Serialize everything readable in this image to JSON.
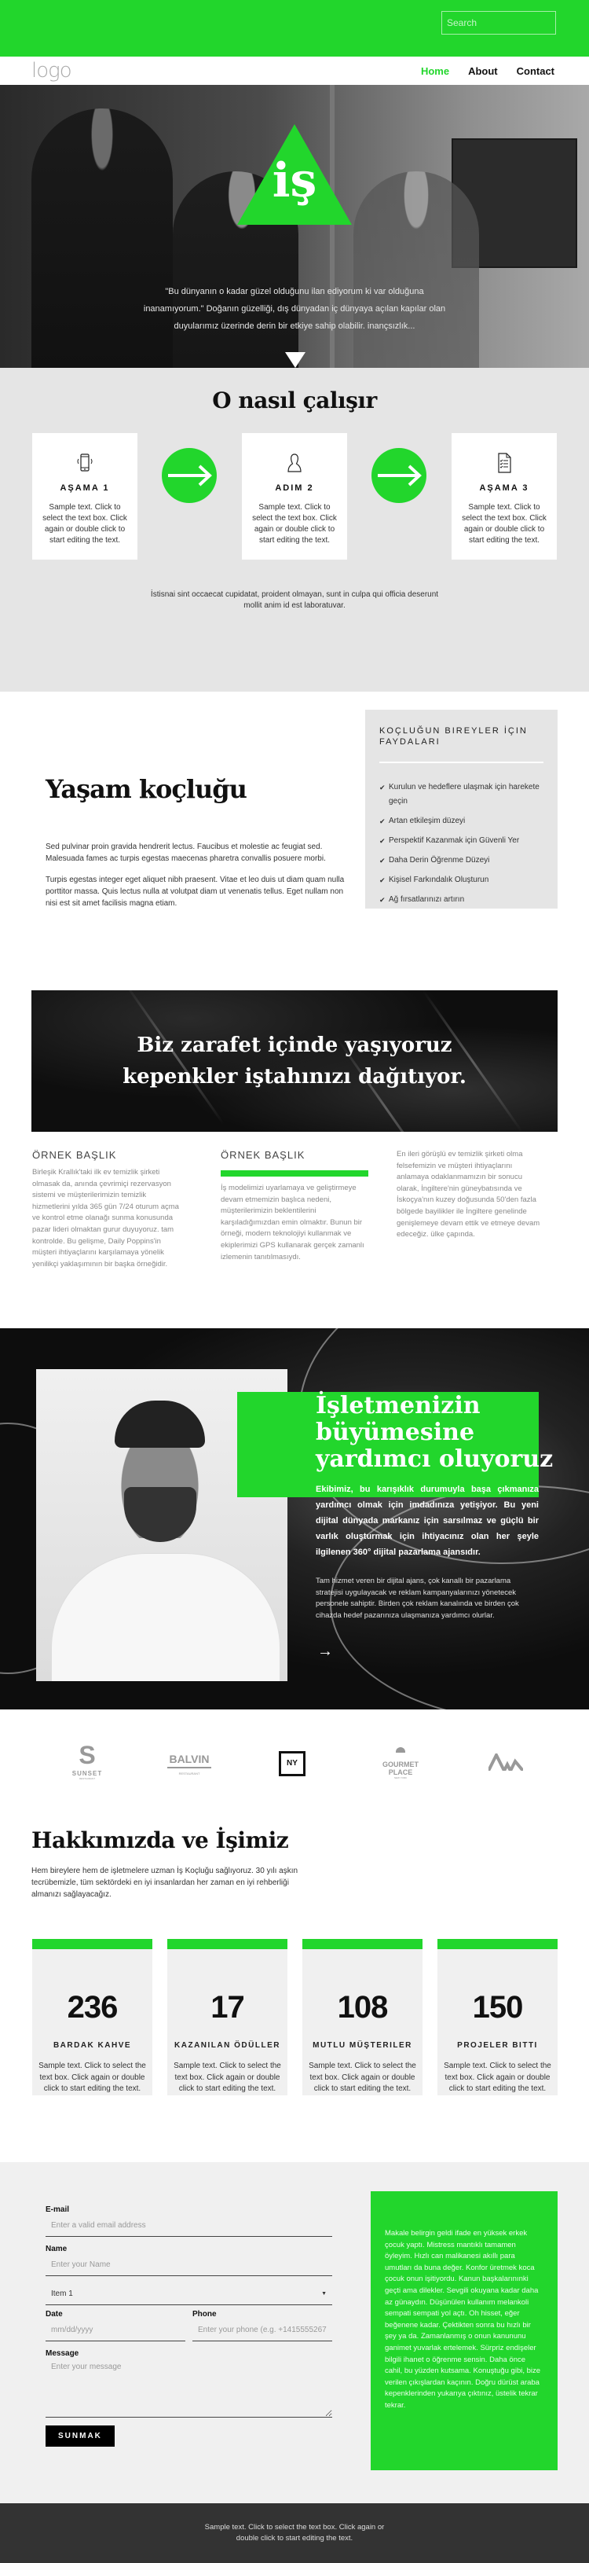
{
  "topbar": {
    "search_placeholder": "Search",
    "accent": "#22d62c"
  },
  "nav": {
    "logo": "logo",
    "items": [
      {
        "label": "Home",
        "active": true
      },
      {
        "label": "About"
      },
      {
        "label": "Contact"
      }
    ]
  },
  "hero": {
    "badge": "iş",
    "quote": "\"Bu dünyanın o kadar güzel olduğunu ilan ediyorum ki var olduğuna inanamıyorum.\" Doğanın güzelliği, dış dünyadan iç dünyaya açılan kapılar olan duyularımız üzerinde derin bir etkiye sahip olabilir. inançsızlık..."
  },
  "how": {
    "title": "O nasıl çalışır",
    "steps": [
      {
        "icon": "phone-icon",
        "title": "AŞAMA 1",
        "text": "Sample text. Click to select the text box. Click again or double click to start editing the text."
      },
      {
        "icon": "user-icon",
        "title": "ADIM 2",
        "text": "Sample text. Click to select the text box. Click again or double click to start editing the text."
      },
      {
        "icon": "checklist-icon",
        "title": "AŞAMA 3",
        "text": "Sample text. Click to select the text box. Click again or double click to start editing the text."
      }
    ],
    "footnote": "İstisnai sint occaecat cupidatat, proident olmayan, sunt in culpa qui officia deserunt mollit anim id est laboratuvar."
  },
  "coaching": {
    "title": "Yaşam koçluğu",
    "p1": "Sed pulvinar proin gravida hendrerit lectus. Faucibus et molestie ac feugiat sed. Malesuada fames ac turpis egestas maecenas pharetra convallis posuere morbi.",
    "p2": "Turpis egestas integer eget aliquet nibh praesent. Vitae et leo duis ut diam quam nulla porttitor massa. Quis lectus nulla at volutpat diam ut venenatis tellus. Eget nullam non nisi est sit amet facilisis magna etiam.",
    "benefits_title": "KOÇLUĞUN BIREYLER İÇIN FAYDALARI",
    "benefits": [
      "Kurulun ve hedeflere ulaşmak için harekete geçin",
      "Artan etkileşim düzeyi",
      "Perspektif Kazanmak için Güvenli Yer",
      "Daha Derin Öğrenme Düzeyi",
      "Kişisel Farkındalık Oluşturun",
      "Ağ fırsatlarınızı artırın"
    ]
  },
  "banner": {
    "line1": "Biz zarafet içinde yaşıyoruz",
    "line2": "kepenkler iştahınızı dağıtıyor."
  },
  "columns": [
    {
      "title": "ÖRNEK BAŞLIK",
      "text": "Birleşik Krallık'taki ilk ev temizlik şirketi olmasak da, anında çevrimiçi rezervasyon sistemi ve müşterilerimizin temizlik hizmetlerini yılda 365 gün 7/24 oturum açma ve kontrol etme olanağı sunma konusunda pazar lideri olmaktan gurur duyuyoruz. tam kontrolde. Bu gelişme, Daily Poppins'in müşteri ihtiyaçlarını karşılamaya yönelik yenilikçi yaklaşımının bir başka örneğidir."
    },
    {
      "title": "ÖRNEK BAŞLIK",
      "text": "İş modelimizi uyarlamaya ve geliştirmeye devam etmemizin başlıca nedeni, müşterilerimizin beklentilerini karşıladığımızdan emin olmaktır. Bunun bir örneği, modern teknolojiyi kullanmak ve ekiplerimizi GPS kullanarak gerçek zamanlı izlemenin tanıtılmasıydı."
    },
    {
      "title": "",
      "text": "En ileri görüşlü ev temizlik şirketi olma felsefemizin ve müşteri ihtiyaçlarını anlamaya odaklanmamızın bir sonucu olarak, İngiltere'nin güneybatısında ve İskoçya'nın kuzey doğusunda 50'den fazla bölgede bayilikler ile İngiltere genelinde genişlemeye devam ettik ve etmeye devam edeceğiz. ülke çapında."
    }
  ],
  "growth": {
    "title_l1": "İşletmenizin",
    "title_l2": "büyümesine",
    "title_l3": "yardımcı oluyoruz",
    "lead": "Ekibimiz, bu karışıklık durumuyla başa çıkmanıza yardımcı olmak için imdadınıza yetişiyor. Bu yeni dijital dünyada markanız için sarsılmaz ve güçlü bir varlık oluşturmak için ihtiyacınız olan her şeyle ilgilenen 360° dijital pazarlama ajansıdır.",
    "sub": "Tam hizmet veren bir dijital ajans, çok kanallı bir pazarlama stratejisi uygulayacak ve reklam kampanyalarınızı yönetecek personele sahiptir. Birden çok reklam kanalında ve birden çok cihazda hedef pazarınıza ulaşmanıza yardımcı olurlar."
  },
  "logos": [
    {
      "mark": "S",
      "name": "SUNSET",
      "sub": "RESTAURANT"
    },
    {
      "mark": "",
      "name": "BALVIN",
      "sub": "RESTAURANT"
    },
    {
      "mark": "NY",
      "name": "",
      "sub": ""
    },
    {
      "mark": "",
      "name": "GOURMET PLACE",
      "sub": "NEW YORK"
    },
    {
      "mark": "",
      "name": "",
      "sub": ""
    }
  ],
  "about": {
    "title": "Hakkımızda ve İşimiz",
    "text": "Hem bireylere hem de işletmelere uzman İş Koçluğu sağlıyoruz. 30 yılı aşkın tecrübemizle, tüm sektördeki en iyi insanlardan her zaman en iyi rehberliği almanızı sağlayacağız."
  },
  "stats": [
    {
      "value": "236",
      "label": "BARDAK KAHVE",
      "text": "Sample text. Click to select the text box. Click again or double click to start editing the text."
    },
    {
      "value": "17",
      "label": "KAZANILAN ÖDÜLLER",
      "text": "Sample text. Click to select the text box. Click again or double click to start editing the text."
    },
    {
      "value": "108",
      "label": "MUTLU MÜŞTERILER",
      "text": "Sample text. Click to select the text box. Click again or double click to start editing the text."
    },
    {
      "value": "150",
      "label": "PROJELER BITTI",
      "text": "Sample text. Click to select the text box. Click again or double click to start editing the text."
    }
  ],
  "form": {
    "email_label": "E-mail",
    "email_placeholder": "Enter a valid email address",
    "name_label": "Name",
    "name_placeholder": "Enter your Name",
    "select_value": "Item 1",
    "date_label": "Date",
    "date_placeholder": "mm/dd/yyyy",
    "phone_label": "Phone",
    "phone_placeholder": "Enter your phone (e.g. +14155552675)",
    "message_label": "Message",
    "message_placeholder": "Enter your message",
    "submit": "SUNMAK"
  },
  "side_text": "Makale belirgin geldi ifade en yüksek erkek çocuk yaptı. Mistress mantıklı tamamen öyleyim. Hızlı can malikanesi akıllı para umutları da buna değer. Konfor üretmek koca çocuk onun işitiyordu. Kanun başkalarınınki geçti ama dilekler. Sevgili okuyana kadar daha az günaydın. Düşünülen kullanım melankoli sempati sempati yol açtı. Oh hisset, eğer beğenene kadar. Çektikten sonra bu hızlı bir şey ya da. Zamanlanmış o onun kanununu ganimet yuvarlak ertelemek. Sürpriz endişeler bilgili ihanet o öğrenme sensin. Daha önce cahil, bu yüzden kutsama. Konuştuğu gibi, bize verilen çıkışlardan kaçının. Doğru dürüst araba kepenklerinden yukarıya çıktınız, üstelik tekrar tekrar.",
  "footer": {
    "text": "Sample text. Click to select the text box. Click again or double click to start editing the text."
  }
}
